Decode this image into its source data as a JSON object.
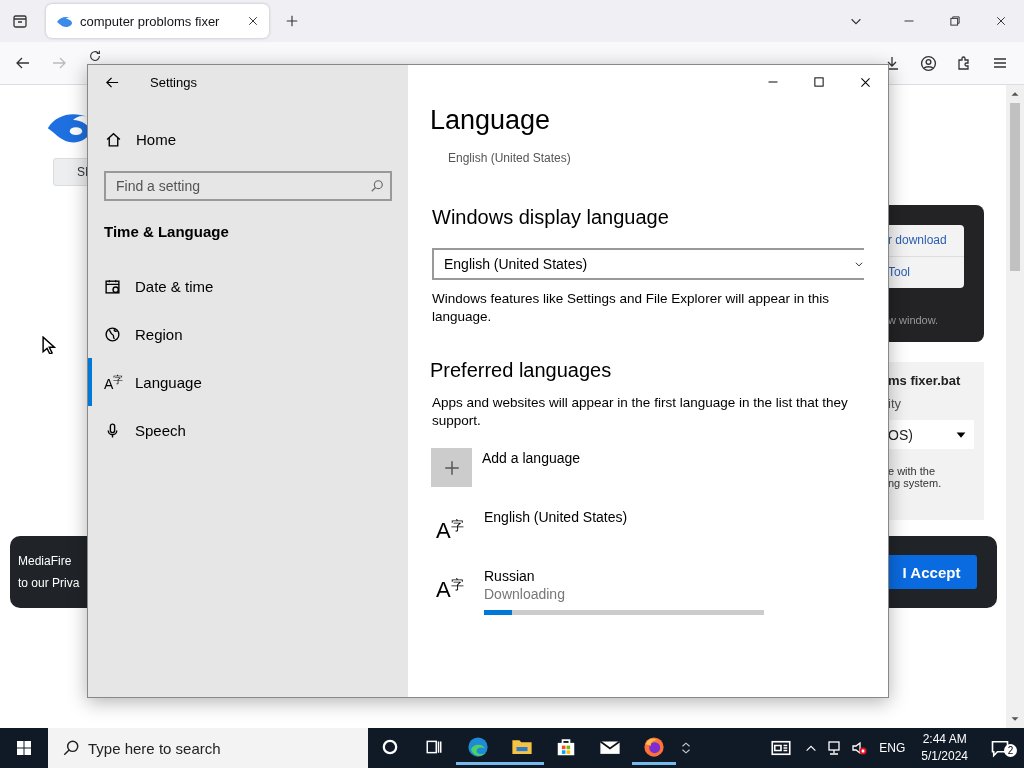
{
  "browser": {
    "tabs": [
      {
        "title": "computer probloms fixer",
        "selected": true
      }
    ]
  },
  "page": {
    "signin_button": "SI",
    "download_panel": {
      "links": [
        "r download",
        "Tool"
      ],
      "note": "w window."
    },
    "file_panel": {
      "title": "ms fixer.bat",
      "label": "ity",
      "select_value": "OS)",
      "note_lines": [
        "e with the",
        "ng system."
      ]
    },
    "cookie_banner": {
      "lines": [
        "MediaFire",
        "to our Priva"
      ],
      "accept_button": "I Accept"
    }
  },
  "settings": {
    "title": "Settings",
    "home": "Home",
    "search_placeholder": "Find a setting",
    "section": "Time & Language",
    "nav": [
      {
        "label": "Date & time",
        "kind": "calendar",
        "selected": false
      },
      {
        "label": "Region",
        "kind": "globe",
        "selected": false
      },
      {
        "label": "Language",
        "kind": "glyph",
        "glyph": "A$^{字}$",
        "selected": true
      },
      {
        "label": "Speech",
        "kind": "mic",
        "selected": false
      }
    ],
    "page_title": "Language",
    "current_language": "English (United States)",
    "display_language": {
      "heading": "Windows display language",
      "value": "English (United States)",
      "description": "Windows features like Settings and File Explorer will appear in this language."
    },
    "preferred": {
      "heading": "Preferred languages",
      "description": "Apps and websites will appear in the first language in the list that they support.",
      "add_label": "Add a language",
      "languages": [
        {
          "glyph": "A$^{字}$",
          "name": "English (United States)"
        },
        {
          "glyph": "A$^{字}$",
          "name": "Russian",
          "status": "Downloading",
          "level": 0.1
        }
      ]
    }
  },
  "taskbar": {
    "search_placeholder": "Type here to search",
    "apps": [
      {
        "kind": "cortana",
        "running": false
      },
      {
        "kind": "taskview",
        "running": false
      },
      {
        "kind": "edge",
        "running": true
      },
      {
        "kind": "explorer",
        "running": true
      },
      {
        "kind": "store",
        "running": false
      },
      {
        "kind": "mail",
        "running": false
      },
      {
        "kind": "firefox",
        "running": true
      }
    ],
    "language": "ENG",
    "time": "2:44 AM",
    "date": "5/1/2024",
    "notifications": "2"
  }
}
